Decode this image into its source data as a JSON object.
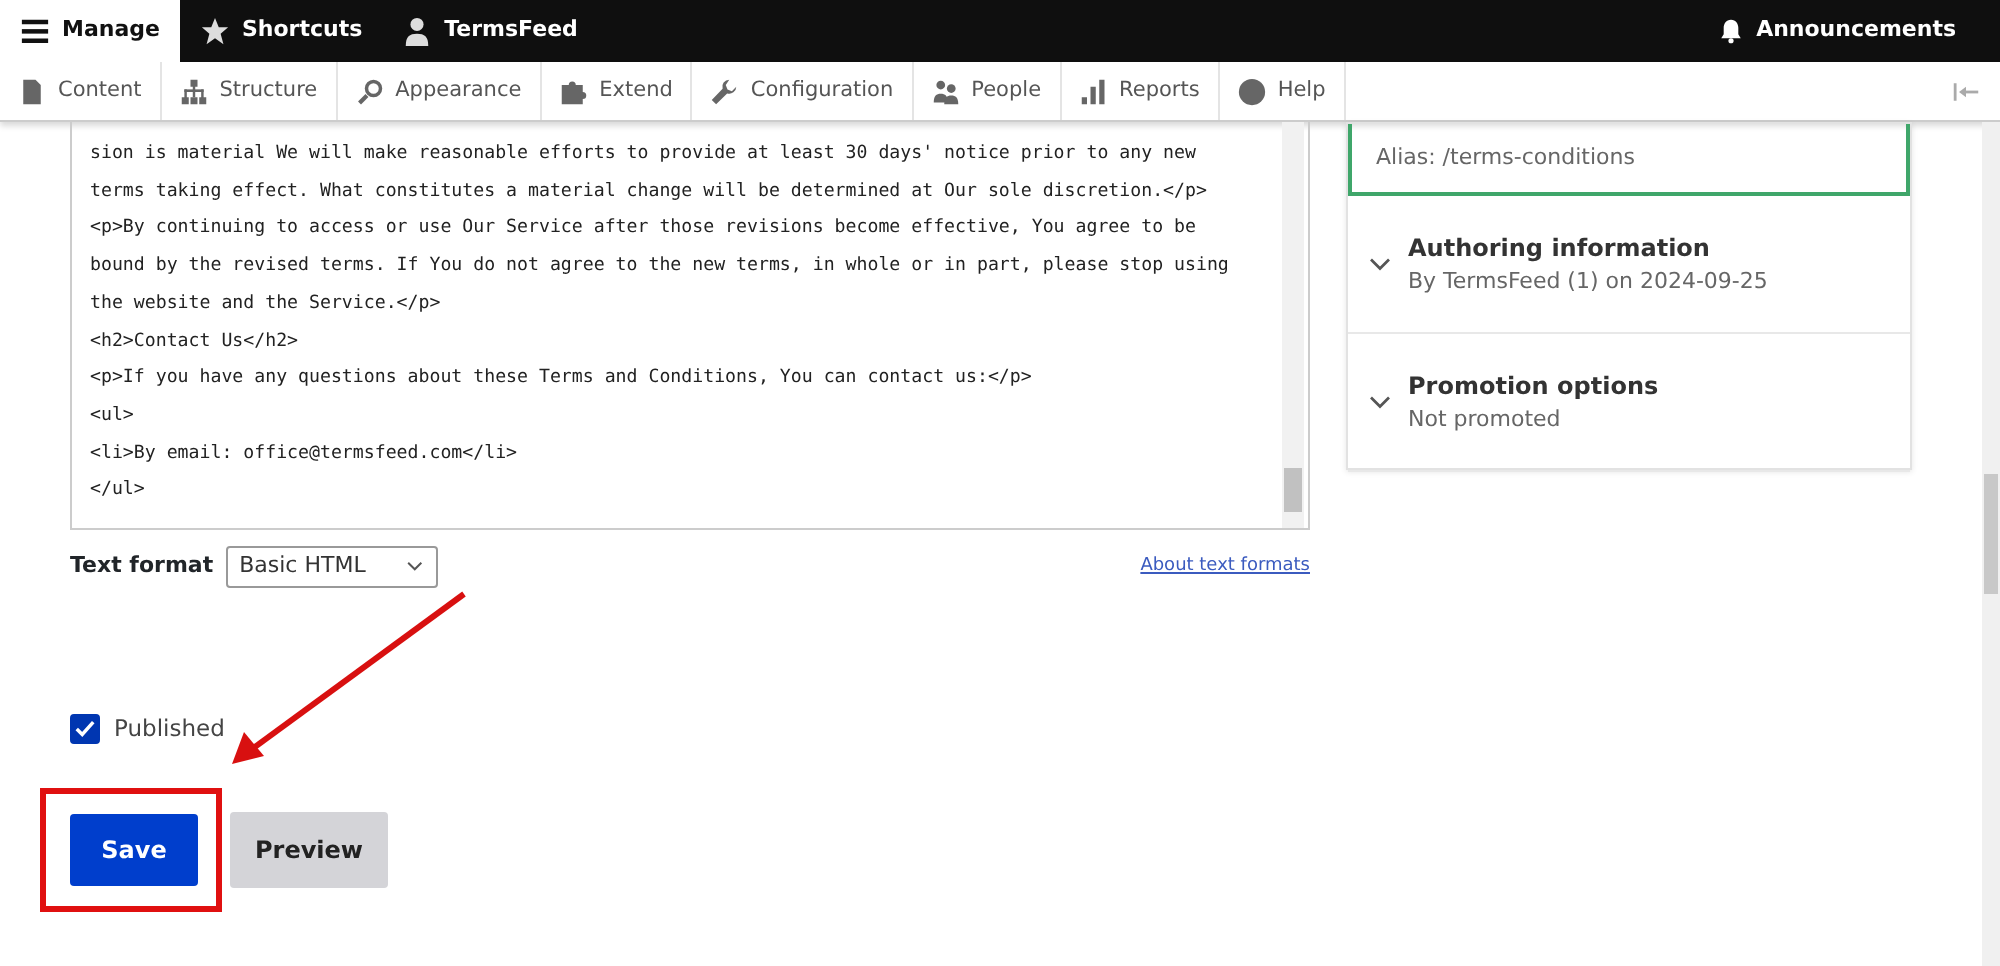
{
  "toolbar": {
    "tabs": [
      {
        "label": "Manage",
        "selected": true
      },
      {
        "label": "Shortcuts",
        "selected": false
      },
      {
        "label": "TermsFeed",
        "selected": false
      }
    ],
    "announcements": "Announcements"
  },
  "admin_menu": [
    "Content",
    "Structure",
    "Appearance",
    "Extend",
    "Configuration",
    "People",
    "Reports",
    "Help"
  ],
  "editor": {
    "lines": [
      "sion is material We will make reasonable efforts to provide at least 30 days' notice prior to any new",
      "terms taking effect. What constitutes a material change will be determined at Our sole discretion.</p>",
      "<p>By continuing to access or use Our Service after those revisions become effective, You agree to be",
      "bound by the revised terms. If You do not agree to the new terms, in whole or in part, please stop using",
      "the website and the Service.</p>",
      "<h2>Contact Us</h2>",
      "<p>If you have any questions about these Terms and Conditions, You can contact us:</p>",
      "<ul>",
      "<li>By email: office@termsfeed.com</li>",
      "</ul>"
    ]
  },
  "text_format": {
    "label": "Text format",
    "value": "Basic HTML",
    "link": "About text formats"
  },
  "published": {
    "label": "Published",
    "checked": true
  },
  "buttons": [
    {
      "label": "Save",
      "kind": "primary"
    },
    {
      "label": "Preview",
      "kind": "secondary"
    }
  ],
  "sidebar": {
    "sections": [
      {
        "summary": "Alias: /terms-conditions",
        "focused": true
      },
      {
        "title": "Authoring information",
        "summary": "By TermsFeed (1) on 2024-09-25",
        "focused": false
      },
      {
        "title": "Promotion options",
        "summary": "Not promoted",
        "focused": false
      }
    ]
  }
}
